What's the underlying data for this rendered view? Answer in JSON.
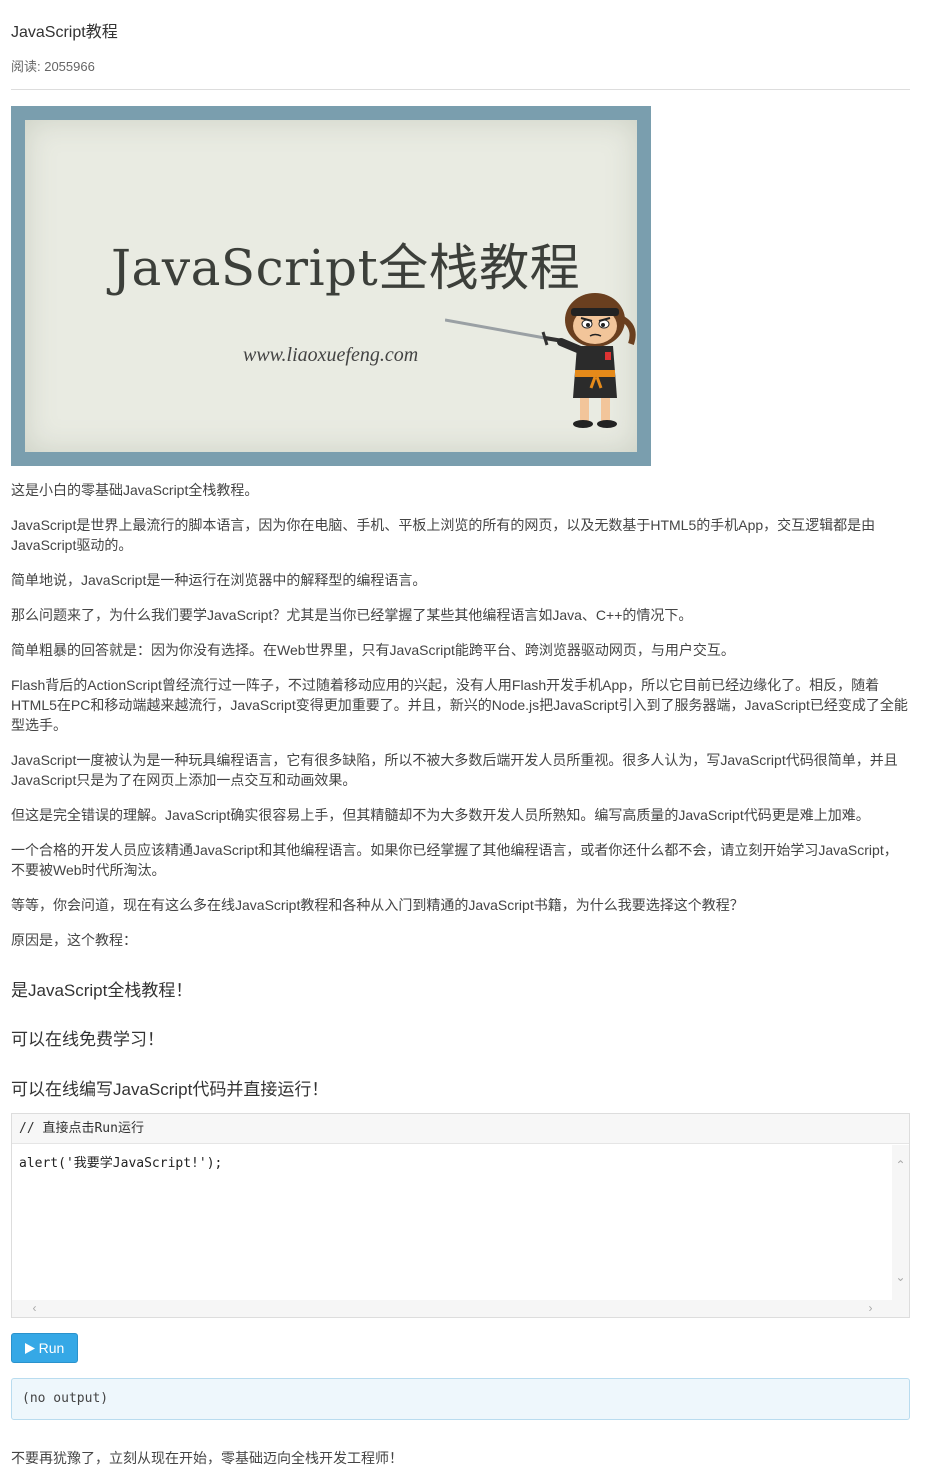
{
  "header": {
    "title": "JavaScript教程",
    "reads": "阅读: 2055966"
  },
  "banner": {
    "title": "JavaScript全栈教程",
    "url": "www.liaoxuefeng.com"
  },
  "paragraphs": [
    "这是小白的零基础JavaScript全栈教程。",
    "JavaScript是世界上最流行的脚本语言，因为你在电脑、手机、平板上浏览的所有的网页，以及无数基于HTML5的手机App，交互逻辑都是由JavaScript驱动的。",
    "简单地说，JavaScript是一种运行在浏览器中的解释型的编程语言。",
    "那么问题来了，为什么我们要学JavaScript？尤其是当你已经掌握了某些其他编程语言如Java、C++的情况下。",
    "简单粗暴的回答就是：因为你没有选择。在Web世界里，只有JavaScript能跨平台、跨浏览器驱动网页，与用户交互。",
    "Flash背后的ActionScript曾经流行过一阵子，不过随着移动应用的兴起，没有人用Flash开发手机App，所以它目前已经边缘化了。相反，随着HTML5在PC和移动端越来越流行，JavaScript变得更加重要了。并且，新兴的Node.js把JavaScript引入到了服务器端，JavaScript已经变成了全能型选手。",
    "JavaScript一度被认为是一种玩具编程语言，它有很多缺陷，所以不被大多数后端开发人员所重视。很多人认为，写JavaScript代码很简单，并且JavaScript只是为了在网页上添加一点交互和动画效果。",
    "但这是完全错误的理解。JavaScript确实很容易上手，但其精髓却不为大多数开发人员所熟知。编写高质量的JavaScript代码更是难上加难。",
    "一个合格的开发人员应该精通JavaScript和其他编程语言。如果你已经掌握了其他编程语言，或者你还什么都不会，请立刻开始学习JavaScript，不要被Web时代所淘汰。",
    "等等，你会问道，现在有这么多在线JavaScript教程和各种从入门到精通的JavaScript书籍，为什么我要选择这个教程？",
    "原因是，这个教程："
  ],
  "headings": [
    "是JavaScript全栈教程！",
    "可以在线免费学习！",
    "可以在线编写JavaScript代码并直接运行！"
  ],
  "editor": {
    "comment": "// 直接点击Run运行",
    "code": "alert('我要学JavaScript!');"
  },
  "run_button": {
    "icon": "play-icon",
    "label": "Run"
  },
  "output": {
    "text": "(no output)"
  },
  "footer_text": "不要再犹豫了，立刻从现在开始，零基础迈向全栈开发工程师！"
}
